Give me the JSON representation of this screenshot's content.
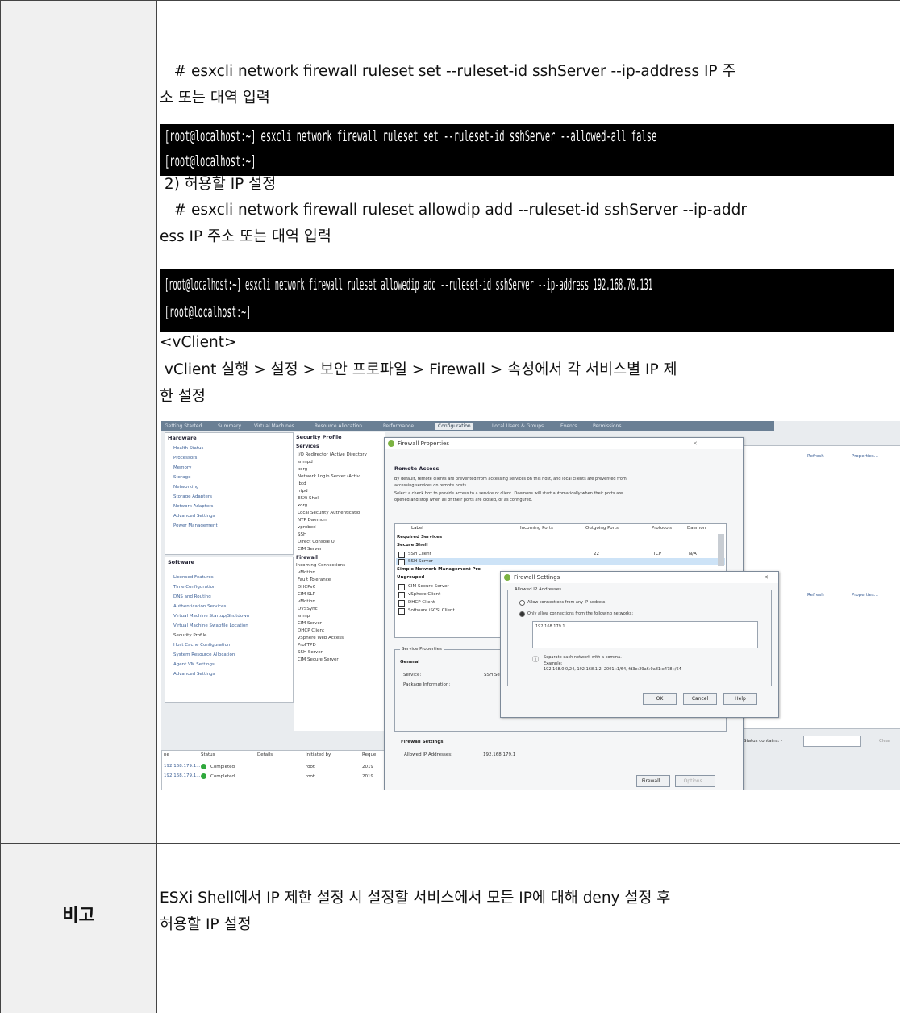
{
  "step1_cmd_line1": "   # esxcli network firewall ruleset set --ruleset-id sshServer --ip-address IP 주",
  "step1_cmd_line2": "소 또는 대역 입력",
  "terminal1": {
    "line1": "[root@localhost:~] esxcli network firewall ruleset set --ruleset-id sshServer --allowed-all false",
    "line2": "[root@localhost:~]"
  },
  "step2_heading": " 2) 허용할 IP 설정",
  "step2_cmd_line1": "   # esxcli network firewall ruleset allowdip add --ruleset-id sshServer --ip-addr",
  "step2_cmd_line2": "ess IP 주소 또는 대역 입력",
  "terminal2": {
    "line1": "[root@localhost:~] esxcli network firewall ruleset allowedip add --ruleset-id sshServer --ip-address 192.168.70.131",
    "line2": "[root@localhost:~]"
  },
  "vclient_heading": "<vClient>",
  "vclient_desc_line1": " vClient 실행 > 설정 > 보안 프로파일 > Firewall > 속성에서 각 서비스별 IP 제",
  "vclient_desc_line2": "한 설정",
  "remarks_label": "비고",
  "remarks_line1": "ESXi Shell에서 IP 제한 설정 시 설정할 서비스에서 모든 IP에 대해 deny 설정 후",
  "remarks_line2": "허용할 IP 설정",
  "screenshot": {
    "tabs": [
      "Getting Started",
      "Summary",
      "Virtual Machines",
      "Resource Allocation",
      "Performance",
      "Configuration",
      "Local Users & Groups",
      "Events",
      "Permissions"
    ],
    "hardware_title": "Hardware",
    "hardware_items": [
      "Health Status",
      "Processors",
      "Memory",
      "Storage",
      "Networking",
      "Storage Adapters",
      "Network Adapters",
      "Advanced Settings",
      "Power Management"
    ],
    "software_title": "Software",
    "software_items": [
      "Licensed Features",
      "Time Configuration",
      "DNS and Routing",
      "Authentication Services",
      "Virtual Machine Startup/Shutdown",
      "Virtual Machine Swapfile Location",
      "Security Profile",
      "Host Cache Configuration",
      "System Resource Allocation",
      "Agent VM Settings",
      "Advanced Settings"
    ],
    "security_profile_title": "Security Profile",
    "services_title": "Services",
    "services_items": [
      "I/O Redirector (Active Directory",
      "snmpd",
      "xorg",
      "Network Login Server (Activ",
      "lbtd",
      "ntpd",
      "ESXi Shell",
      "xorg",
      "Local Security Authenticatio",
      "NTP Daemon",
      "vprobed",
      "SSH",
      "Direct Console UI",
      "CIM Server"
    ],
    "firewall_title": "Firewall",
    "firewall_items": [
      "Incoming Connections",
      "vMotion",
      "Fault Tolerance",
      "DHCPv6",
      "CIM SLP",
      "vMotion",
      "DVSSync",
      "snmp",
      "CIM Server",
      "DHCP Client",
      "vSphere Web Access",
      "ProFTPD",
      "SSH Server",
      "CIM Secure Server"
    ],
    "refresh": "Refresh",
    "properties": "Properties...",
    "fw_dialog_title": "Firewall Properties",
    "remote_access": "Remote Access",
    "remote_desc1": "By default, remote clients are prevented from accessing services on this host, and local clients are prevented from",
    "remote_desc2": "accessing services on remote hosts.",
    "remote_desc3": "Select a check box to provide access to a service or client. Daemons will start automatically when their ports are",
    "remote_desc4": "opened and stop when all of their ports are closed, or as configured.",
    "cols": [
      "Label",
      "Incoming Ports",
      "Outgoing Ports",
      "Protocols",
      "Daemon"
    ],
    "groups": [
      "Required Services",
      "Secure Shell"
    ],
    "rows": [
      "SSH Client",
      "SSH Server"
    ],
    "snmp_group": "Simple Network Management Pro",
    "ungrouped": "Ungrouped",
    "ungrouped_rows": [
      "CIM Secure Server",
      "vSphere Client",
      "DHCP Client",
      "Software iSCSI Client"
    ],
    "ssh_port": "22",
    "ssh_proto": "TCP",
    "ssh_daemon": "N/A",
    "service_props": "Service Properties",
    "general": "General",
    "service_label": "Service:",
    "service_value": "SSH Se",
    "package_label": "Package Information:",
    "fw_settings": "Firewall Settings",
    "allowed_ip_label": "Allowed IP Addresses:",
    "allowed_ip_value": "192.168.179.1",
    "firewall_btn": "Firewall...",
    "options_btn": "Options...",
    "fs_dialog_title": "Firewall Settings",
    "allowed_ip_group": "Allowed IP Addresses",
    "radio1": "Allow connections from any IP address",
    "radio2": "Only allow connections from the following networks:",
    "ip_box": "192.168.179.1",
    "hint1": "Separate each network with a comma.",
    "hint2": "Example:",
    "hint3": "192.168.0.0/24, 192.168.1.2, 2001::1/64, fd3e:29a6:0a81:e478::/64",
    "ok": "OK",
    "cancel": "Cancel",
    "help": "Help",
    "status_contains": "Status contains: -",
    "clear": "Clear",
    "task_cols": [
      "ne",
      "Status",
      "Details",
      "Initiated by",
      "Reque"
    ],
    "tasks": [
      {
        "name": "192.168.179.1...",
        "status": "Completed",
        "init": "root",
        "req": "2019"
      },
      {
        "name": "192.168.179.1...",
        "status": "Completed",
        "init": "root",
        "req": "2019"
      }
    ]
  }
}
